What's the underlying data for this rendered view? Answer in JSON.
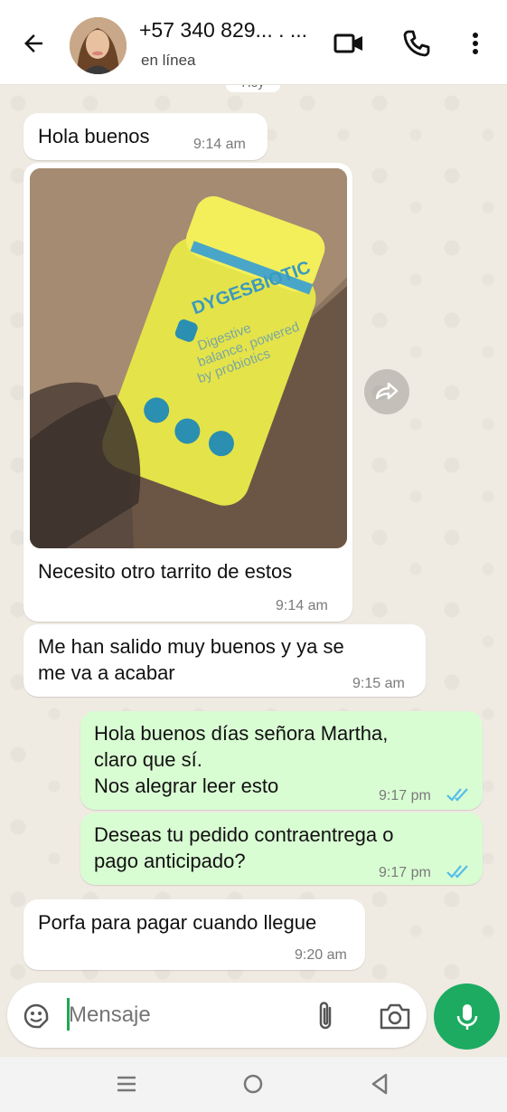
{
  "header": {
    "contact_name": "+57 340 829... . ...",
    "status": "en línea",
    "back_icon": "arrow-left-icon",
    "video_icon": "video-camera-icon",
    "call_icon": "phone-icon",
    "menu_icon": "more-vertical-icon"
  },
  "chat": {
    "date_chip": "Hoy",
    "messages": [
      {
        "direction": "in",
        "text": "Hola buenos",
        "time": "9:14 am"
      },
      {
        "direction": "in",
        "type": "image",
        "caption": "Necesito otro tarrito de estos",
        "time": "9:14 am",
        "image_text": {
          "brand": "DYGESBIOTIC",
          "line1": "Digestive",
          "line2": "balance, powered",
          "line3": "by probiotics"
        }
      },
      {
        "direction": "in",
        "lines": [
          "Me han salido muy buenos y ya se",
          "me va a acabar"
        ],
        "time": "9:15 am"
      },
      {
        "direction": "out",
        "lines": [
          "Hola buenos días señora Martha,",
          "claro que sí.",
          "Nos alegrar leer esto"
        ],
        "time": "9:17 pm",
        "read": true
      },
      {
        "direction": "out",
        "lines": [
          "Deseas tu pedido contraentrega o",
          "pago anticipado?"
        ],
        "time": "9:17 pm",
        "read": true
      },
      {
        "direction": "in",
        "text": "Porfa para pagar cuando llegue",
        "time": "9:20 am"
      }
    ]
  },
  "input": {
    "placeholder": "Mensaje",
    "sticker_icon": "sticker-icon",
    "attach_icon": "paperclip-icon",
    "camera_icon": "camera-icon",
    "mic_icon": "microphone-icon"
  },
  "navbar": {
    "recents_icon": "recent-apps-icon",
    "home_icon": "home-circle-icon",
    "back_icon": "nav-back-icon"
  },
  "colors": {
    "incoming_bubble": "#ffffff",
    "outgoing_bubble": "#d9fdd3",
    "accent_green": "#1dab61",
    "read_ticks": "#53bdeb"
  }
}
